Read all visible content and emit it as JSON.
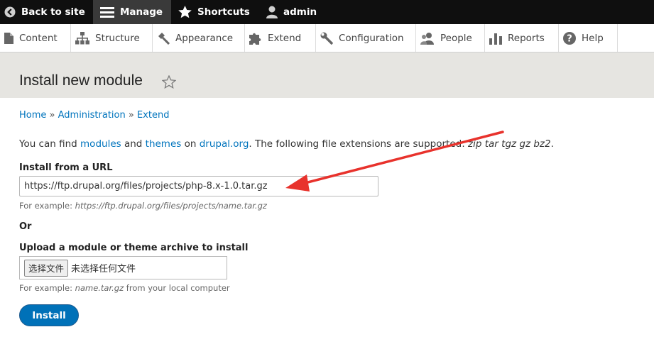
{
  "toolbar": {
    "back": "Back to site",
    "manage": "Manage",
    "shortcuts": "Shortcuts",
    "user": "admin"
  },
  "tray": {
    "content": "Content",
    "structure": "Structure",
    "appearance": "Appearance",
    "extend": "Extend",
    "configuration": "Configuration",
    "people": "People",
    "reports": "Reports",
    "help": "Help"
  },
  "page": {
    "title": "Install new module"
  },
  "breadcrumb": {
    "home": "Home",
    "sep": " » ",
    "administration": "Administration",
    "extend": "Extend"
  },
  "intro": {
    "prefix": "You can find ",
    "modules": "modules",
    "and": " and ",
    "themes": "themes",
    "on": " on ",
    "drupal": "drupal.org",
    "suffix": ". The following file extensions are supported: ",
    "extensions": "zip tar tgz gz bz2",
    "end": "."
  },
  "url_field": {
    "label": "Install from a URL",
    "value": "https://ftp.drupal.org/files/projects/php-8.x-1.0.tar.gz",
    "example_prefix": "For example: ",
    "example": "https://ftp.drupal.org/files/projects/name.tar.gz"
  },
  "or_text": "Or",
  "upload_field": {
    "label": "Upload a module or theme archive to install",
    "button": "选择文件",
    "status": "未选择任何文件",
    "example_prefix": "For example: ",
    "example": "name.tar.gz",
    "example_suffix": " from your local computer"
  },
  "install_button": "Install",
  "colors": {
    "toolbar": "#0f0f0f",
    "link": "#0074bd",
    "button": "#0071b8",
    "annotation_arrow": "#e8322c"
  }
}
